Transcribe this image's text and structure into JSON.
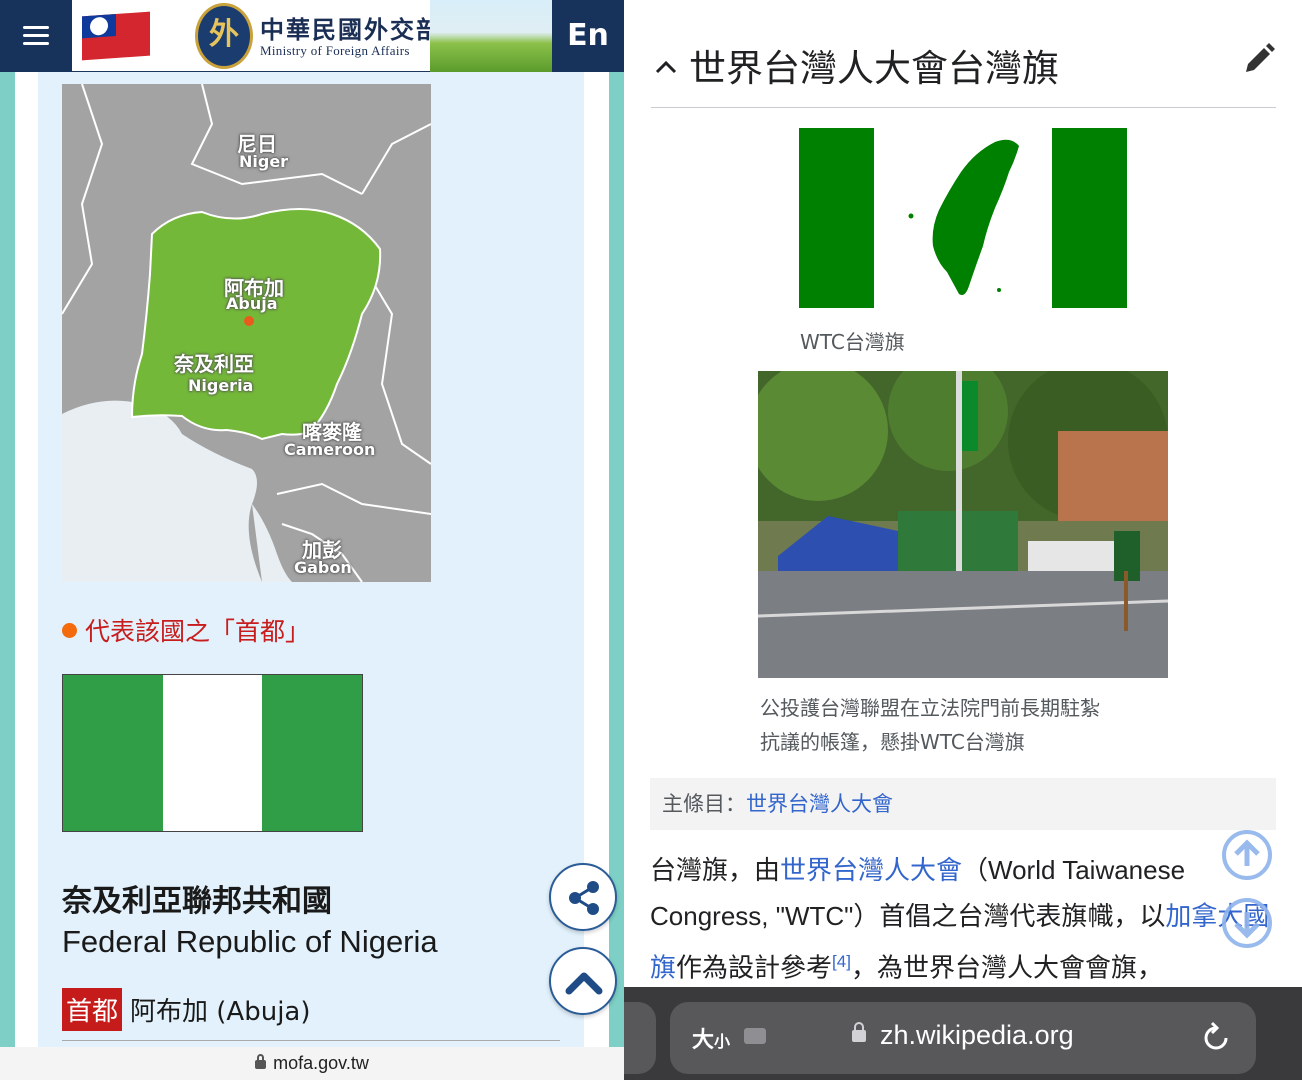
{
  "left_page": {
    "header": {
      "ministry_zh": "中華民國外交部",
      "ministry_en": "Ministry of Foreign Affairs",
      "emblem_text": "外",
      "language_button": "En"
    },
    "map": {
      "labels": {
        "niger_zh": "尼日",
        "niger_en": "Niger",
        "abuja_zh": "阿布加",
        "abuja_en": "Abuja",
        "nigeria_zh": "奈及利亞",
        "nigeria_en": "Nigeria",
        "cameroon_zh": "喀麥隆",
        "cameroon_en": "Cameroon",
        "gabon_zh": "加彭",
        "gabon_en": "Gabon"
      }
    },
    "capital_legend": "代表該國之「首都」",
    "country_name_zh": "奈及利亞聯邦共和國",
    "country_name_en": "Federal Republic of Nigeria",
    "capital_tag": "首都",
    "capital_value": "阿布加 (Abuja)",
    "url": "mofa.gov.tw"
  },
  "right_page": {
    "section_title": "世界台灣人大會台灣旗",
    "flag_caption": "WTC台灣旗",
    "photo_caption_line1": "公投護台灣聯盟在立法院門前長期駐紮",
    "photo_caption_line2": "抗議的帳篷，懸掛WTC台灣旗",
    "hatnote_label": "主條目：",
    "hatnote_link": "世界台灣人大會",
    "body": {
      "p1": "台灣旗，由",
      "link1": "世界台灣人大會",
      "p2": "（World Taiwanese Congress, \"WTC\"）首倡之台灣代表旗幟，以",
      "link2": "加拿大國旗",
      "p3": "作為設計參考",
      "ref": "[4]",
      "p4": "，為世界台灣人大會會旗，"
    },
    "browser": {
      "text_size_label": "大",
      "text_size_small": "小",
      "url": "zh.wikipedia.org"
    }
  },
  "colors": {
    "mofa_navy": "#17325b",
    "nigeria_green": "#2f9e46",
    "wtc_green": "#008000",
    "wiki_link": "#3366cc",
    "capital_red": "#c61b1b"
  },
  "icons": {
    "menu": "hamburger-icon",
    "share": "share-icon",
    "back_to_top": "chevron-up-icon",
    "edit": "pencil-icon",
    "collapse": "chevron-up-icon",
    "lock": "lock-icon",
    "reload": "reload-icon"
  }
}
